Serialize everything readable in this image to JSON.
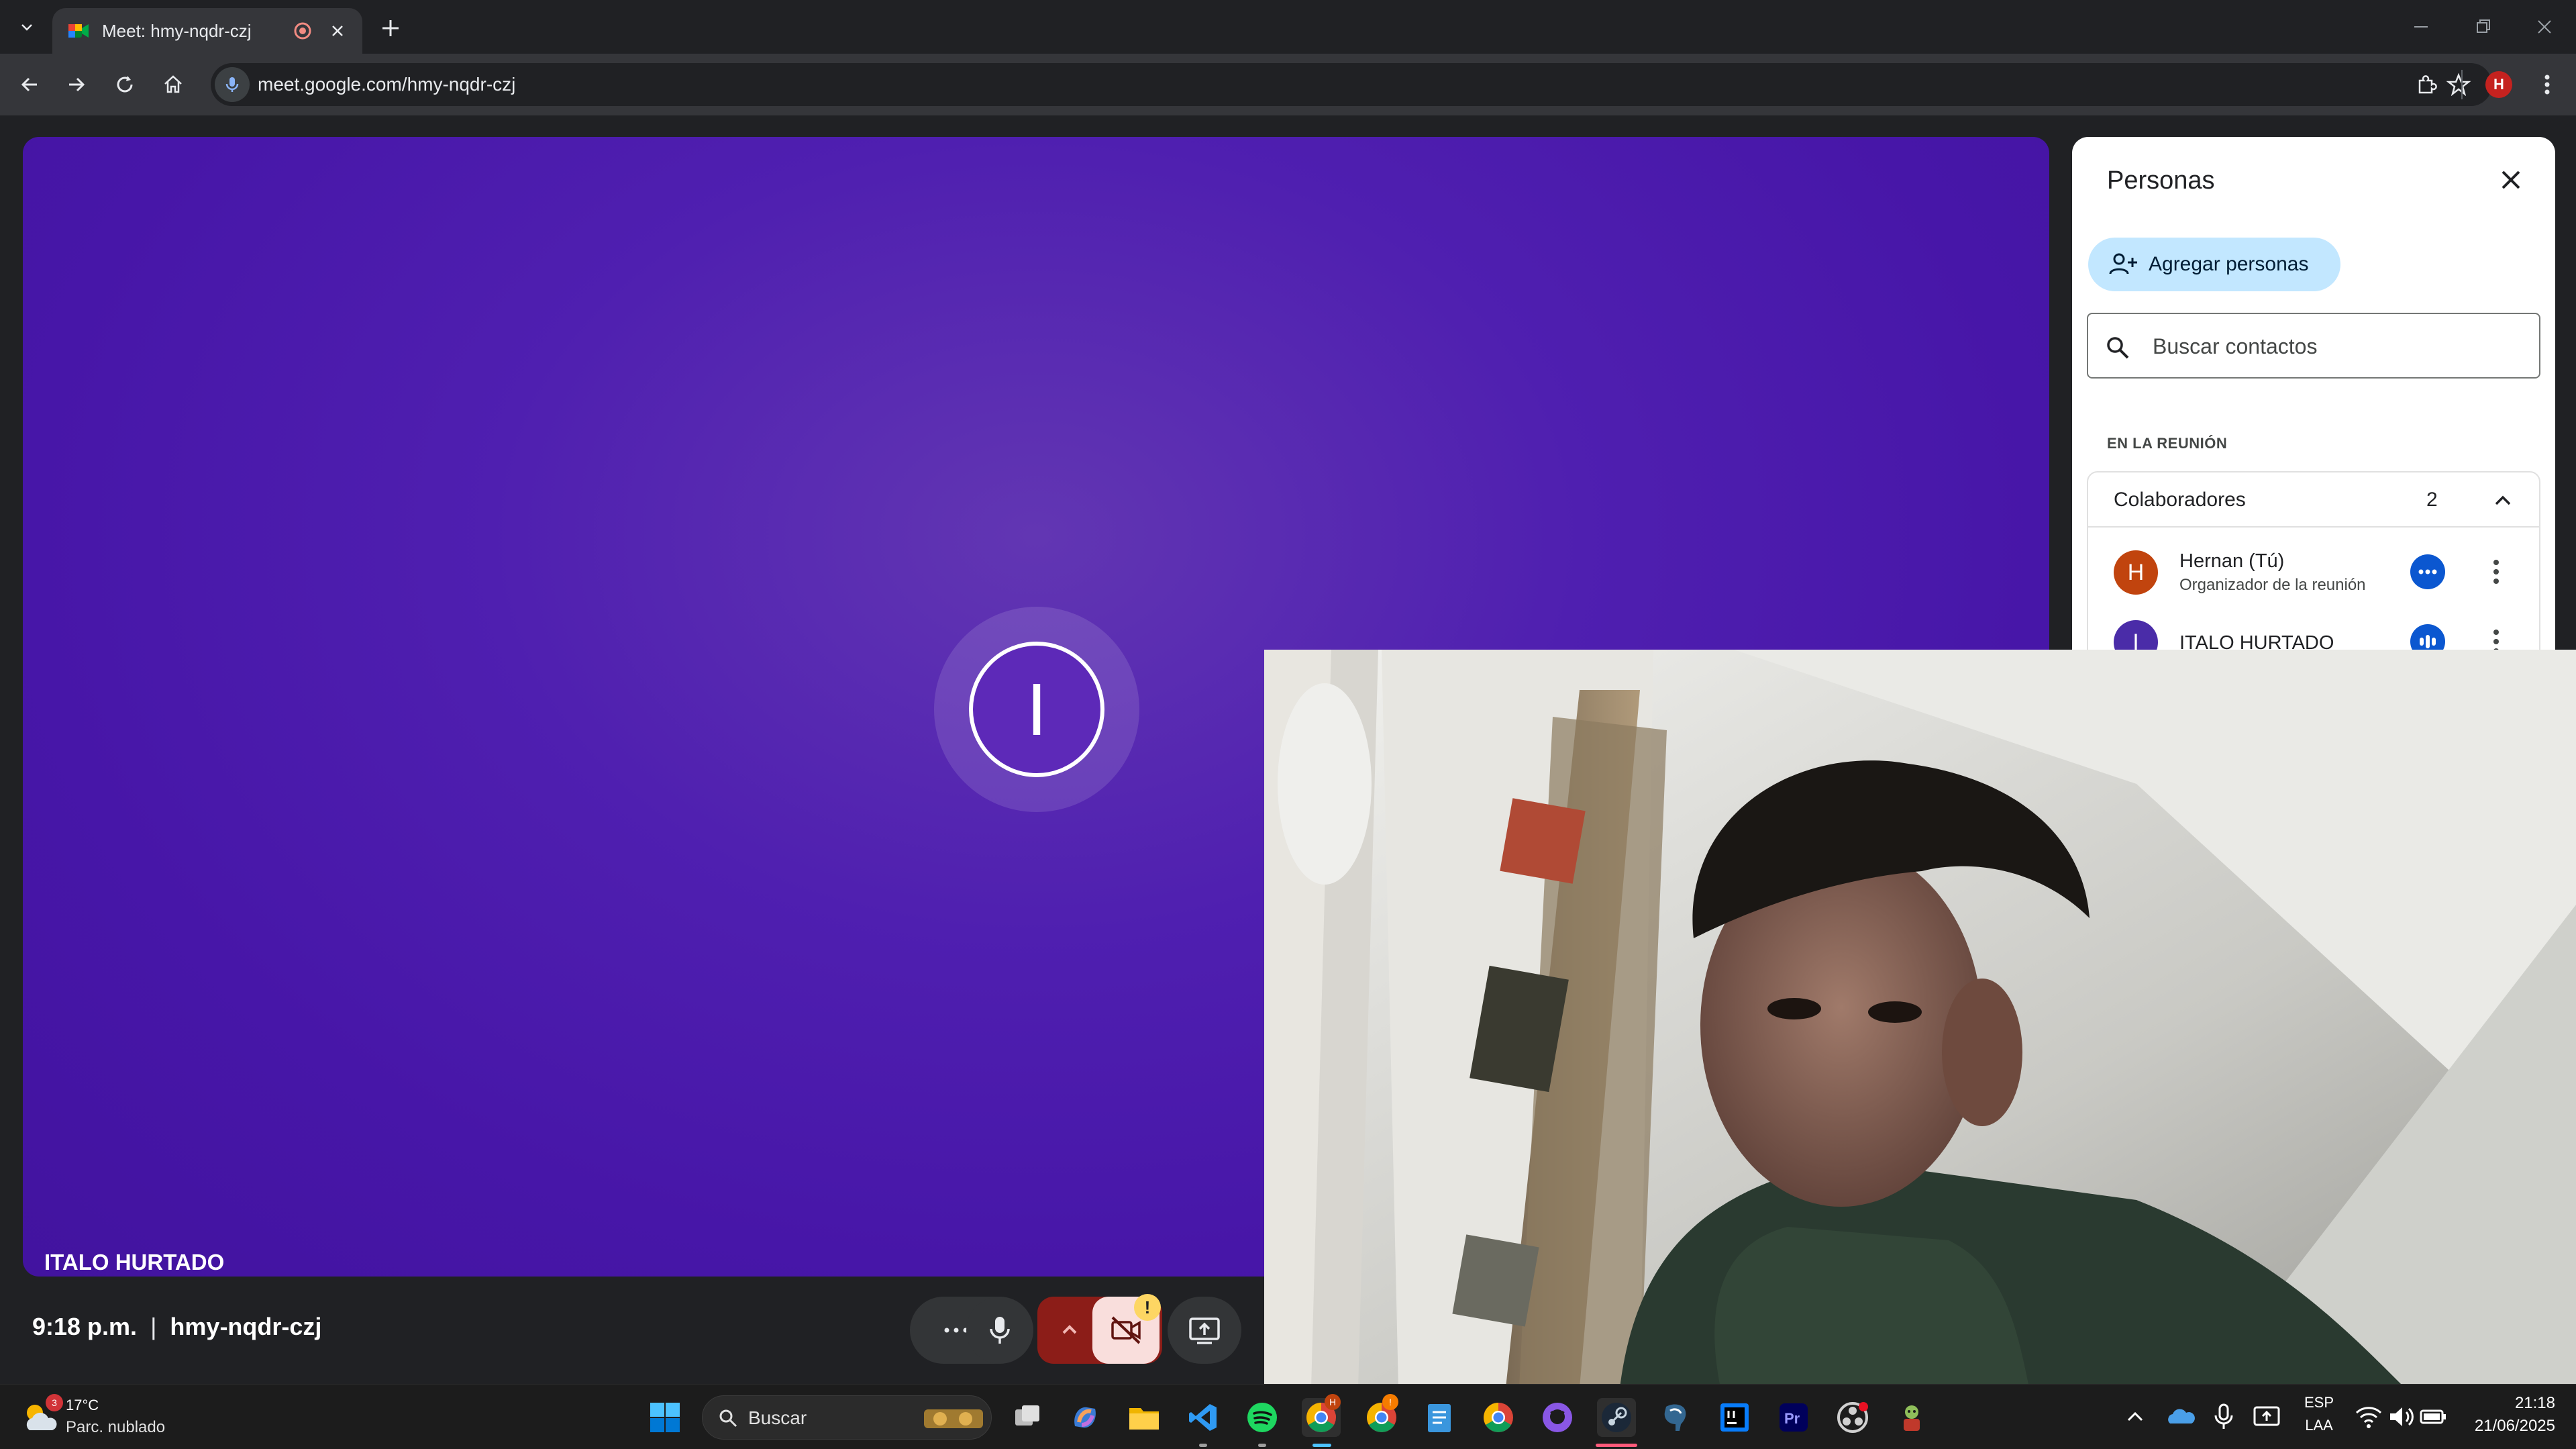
{
  "browser": {
    "tab_title": "Meet: hmy-nqdr-czj",
    "url": "meet.google.com/hmy-nqdr-czj",
    "profile_initial": "H"
  },
  "main_tile": {
    "avatar_initial": "I",
    "participant_name": "ITALO HURTADO",
    "background_color": "#4b1aab"
  },
  "people_panel": {
    "title": "Personas",
    "add_people_label": "Agregar personas",
    "search_placeholder": "Buscar contactos",
    "section_label": "EN LA REUNIÓN",
    "group": {
      "title": "Colaboradores",
      "count": "2"
    },
    "participants": [
      {
        "initial": "H",
        "name": "Hernan (Tú)",
        "role": "Organizador de la reunión",
        "color": "#c1440e"
      },
      {
        "initial": "I",
        "name": "ITALO HURTADO",
        "role": "",
        "color": "#4a2ca8"
      }
    ]
  },
  "meeting_bar": {
    "time": "9:18 p.m.",
    "separator": "|",
    "meeting_code": "hmy-nqdr-czj",
    "camera_alert": "!"
  },
  "taskbar": {
    "weather_badge": "3",
    "weather_temp": "17°C",
    "weather_desc": "Parc. nublado",
    "search_label": "Buscar",
    "chrome_badge": "H",
    "chrome2_badge": "!",
    "language_line1": "ESP",
    "language_line2": "LAA",
    "clock_time": "21:18",
    "clock_date": "21/06/2025"
  },
  "colors": {
    "accent_blue": "#0b57d0",
    "add_people_bg": "#c2e7ff",
    "hangup_red": "#8c1d18",
    "camera_off_pink": "#f9dedc"
  }
}
